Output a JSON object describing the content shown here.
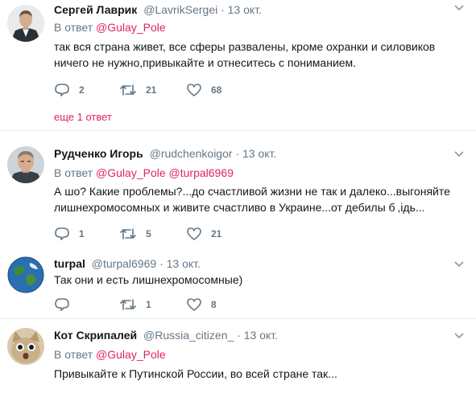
{
  "tweets": [
    {
      "name": "Сергей Лаврик",
      "handle": "@LavrikSergei",
      "dot": "·",
      "date": "13 окт.",
      "reply_prefix": "В ответ",
      "reply_mentions": [
        "@Gulay_Pole"
      ],
      "text_lines": [
        "так вся страна живет, все сферы развалены, кроме охранки и силовиков",
        "ничего не нужно,привыкайте и отнеситесь с пониманием."
      ],
      "replies": "2",
      "retweets": "21",
      "likes": "68",
      "more_replies": "еще 1 ответ"
    },
    {
      "name": "Рудченко Игорь",
      "handle": "@rudchenkoigor",
      "dot": "·",
      "date": "13 окт.",
      "reply_prefix": "В ответ",
      "reply_mentions": [
        "@Gulay_Pole",
        "@turpal6969"
      ],
      "text_lines": [
        "А шо? Какие проблемы?...до счастливой жизни не так и далеко...выгоняйте",
        "лишнехромосомных и живите счастливо в Украине...от дебилы б ,ідь..."
      ],
      "replies": "1",
      "retweets": "5",
      "likes": "21"
    },
    {
      "name": "turpal",
      "handle": "@turpal6969",
      "dot": "·",
      "date": "13 окт.",
      "text_lines": [
        "Так они и есть лишнехромосомные)"
      ],
      "replies": "",
      "retweets": "1",
      "likes": "8"
    },
    {
      "name": "Кот Скрипалей",
      "handle": "@Russia_citizen_",
      "dot": "·",
      "date": "13 окт.",
      "reply_prefix": "В ответ",
      "reply_mentions": [
        "@Gulay_Pole"
      ],
      "text_lines": [
        "Привыкайте к Путинской России, во всей стране так..."
      ]
    }
  ],
  "colors": {
    "text": "#14171a",
    "muted": "#657786",
    "mention": "#e0245e",
    "divider": "#e6ecf0"
  }
}
